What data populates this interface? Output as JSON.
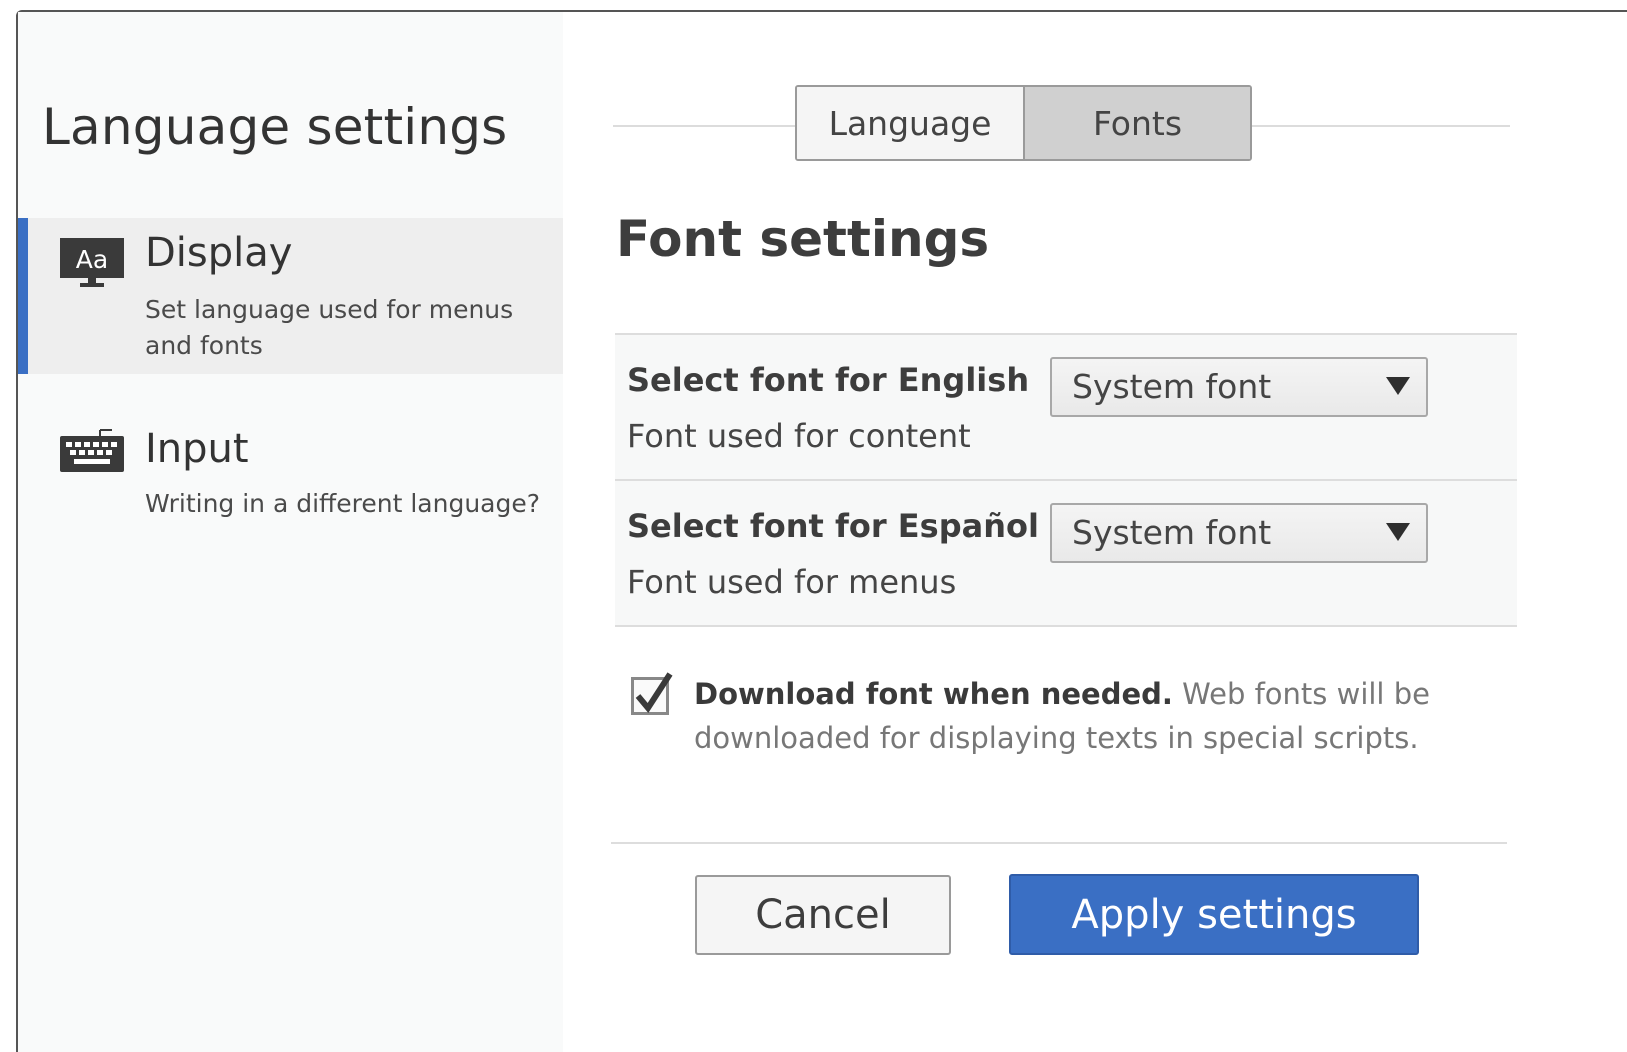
{
  "sidebar": {
    "title": "Language settings",
    "items": [
      {
        "label": "Display",
        "description": "Set language used for menus and fonts",
        "icon": "display-icon",
        "active": true
      },
      {
        "label": "Input",
        "description": "Writing in a different language?",
        "icon": "keyboard-icon",
        "active": false
      }
    ]
  },
  "tabs": [
    {
      "label": "Language",
      "selected": false
    },
    {
      "label": "Fonts",
      "selected": true
    }
  ],
  "main": {
    "title": "Font settings",
    "settings": [
      {
        "label": "Select font for English",
        "description": "Font used for content",
        "value": "System font"
      },
      {
        "label": "Select font for Español",
        "description": "Font used for menus",
        "value": "System font"
      }
    ],
    "download": {
      "checked": true,
      "strong": "Download font when needed.",
      "text": " Web fonts will be downloaded for displaying texts in special scripts."
    }
  },
  "buttons": {
    "cancel": "Cancel",
    "apply": "Apply settings"
  },
  "icons": {
    "display": "Aa"
  },
  "colors": {
    "accent": "#3a6fc4",
    "active_tab": "#d0d0d0"
  }
}
